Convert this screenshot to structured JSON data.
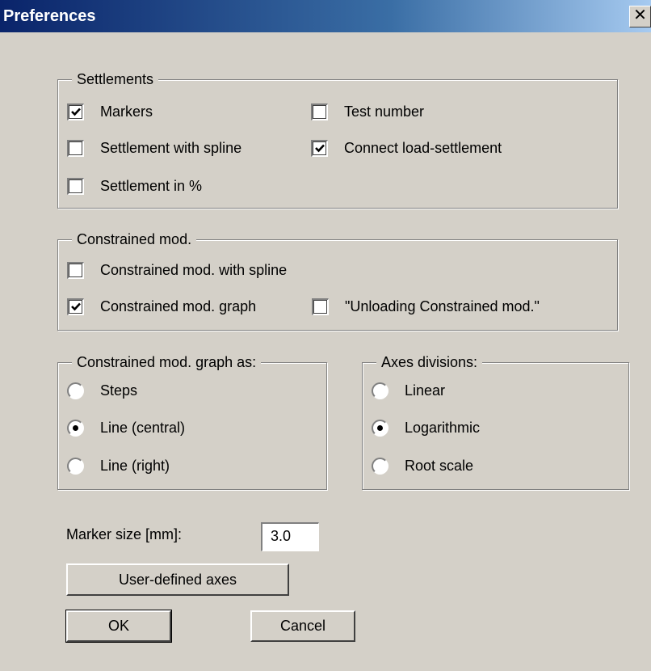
{
  "window": {
    "title": "Preferences",
    "close_glyph": "✕"
  },
  "settlements": {
    "legend": "Settlements",
    "markers": {
      "label": "Markers",
      "checked": true
    },
    "test_number": {
      "label": "Test number",
      "checked": false
    },
    "with_spline": {
      "label": "Settlement with spline",
      "checked": false
    },
    "connect_load": {
      "label": "Connect load-settlement",
      "checked": true
    },
    "in_percent": {
      "label": "Settlement in %",
      "checked": false
    }
  },
  "constrained": {
    "legend": "Constrained mod.",
    "with_spline": {
      "label": "Constrained mod. with spline",
      "checked": false
    },
    "graph": {
      "label": "Constrained mod. graph",
      "checked": true
    },
    "unloading": {
      "label": "\"Unloading Constrained mod.\"",
      "checked": false
    }
  },
  "graph_as": {
    "legend": "Constrained mod. graph as:",
    "options": [
      "Steps",
      "Line (central)",
      "Line (right)"
    ],
    "selected": 1
  },
  "axes_divisions": {
    "legend": "Axes divisions:",
    "options": [
      "Linear",
      "Logarithmic",
      "Root scale"
    ],
    "selected": 1
  },
  "marker_size": {
    "label": "Marker size [mm]:",
    "value": "3.0"
  },
  "buttons": {
    "user_defined_axes": "User-defined axes",
    "ok": "OK",
    "cancel": "Cancel"
  }
}
